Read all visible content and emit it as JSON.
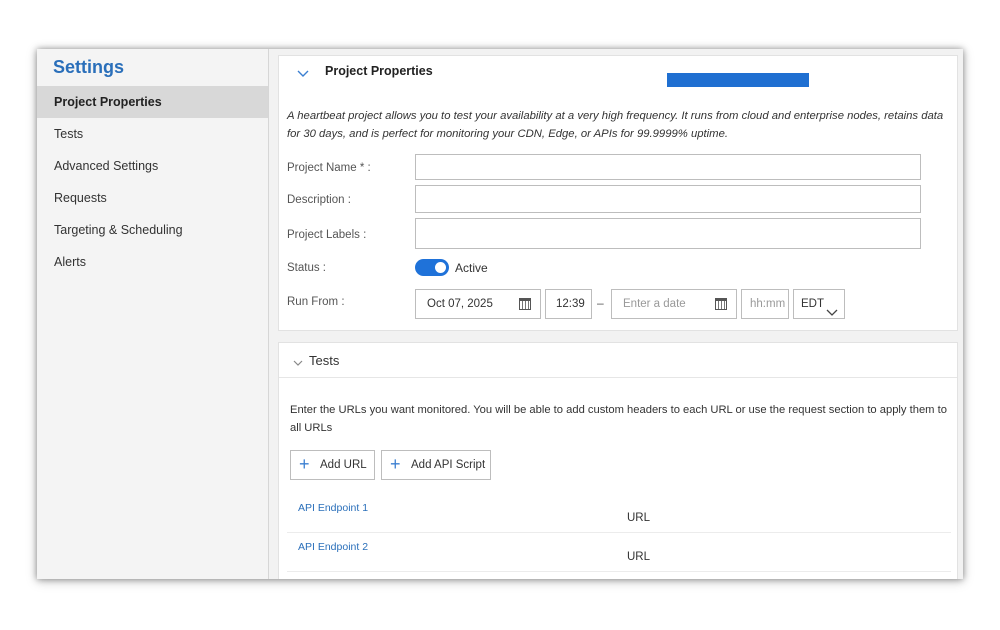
{
  "sidebar": {
    "title": "Settings",
    "items": [
      {
        "label": "Project Properties",
        "active": true
      },
      {
        "label": "Tests",
        "active": false
      },
      {
        "label": "Advanced Settings",
        "active": false
      },
      {
        "label": "Requests",
        "active": false
      },
      {
        "label": "Targeting & Scheduling",
        "active": false
      },
      {
        "label": "Alerts",
        "active": false
      }
    ]
  },
  "project_properties": {
    "title": "Project Properties",
    "description": "A heartbeat project allows you to test your availability at a very high frequency. It runs from cloud and enterprise nodes, retains data for 30 days, and is perfect for monitoring your CDN, Edge, or APIs for 99.9999% uptime.",
    "fields": {
      "project_name_label": "Project Name * :",
      "project_name_value": "",
      "description_label": "Description :",
      "description_value": "",
      "labels_label": "Project Labels :",
      "labels_value": "",
      "status_label": "Status :",
      "status_value": "Active",
      "run_from_label": "Run From :"
    },
    "run_from": {
      "start_date": "Oct 07, 2025",
      "start_time": "12:39",
      "separator": "–",
      "end_date_placeholder": "Enter a date",
      "end_time_placeholder": "hh:mm",
      "timezone": "EDT"
    }
  },
  "tests": {
    "title": "Tests",
    "description": "Enter the URLs you want monitored. You will be able to add custom headers to each URL or use the request section to apply them to all URLs",
    "add_url_label": "Add URL",
    "add_api_script_label": "Add API Script",
    "rows": [
      {
        "name": "API Endpoint 1",
        "type": "URL"
      },
      {
        "name": "API Endpoint 2",
        "type": "URL"
      }
    ]
  },
  "colors": {
    "accent": "#1f72d9",
    "link": "#2a6fba",
    "sidebar_active": "#d8d8d8"
  }
}
